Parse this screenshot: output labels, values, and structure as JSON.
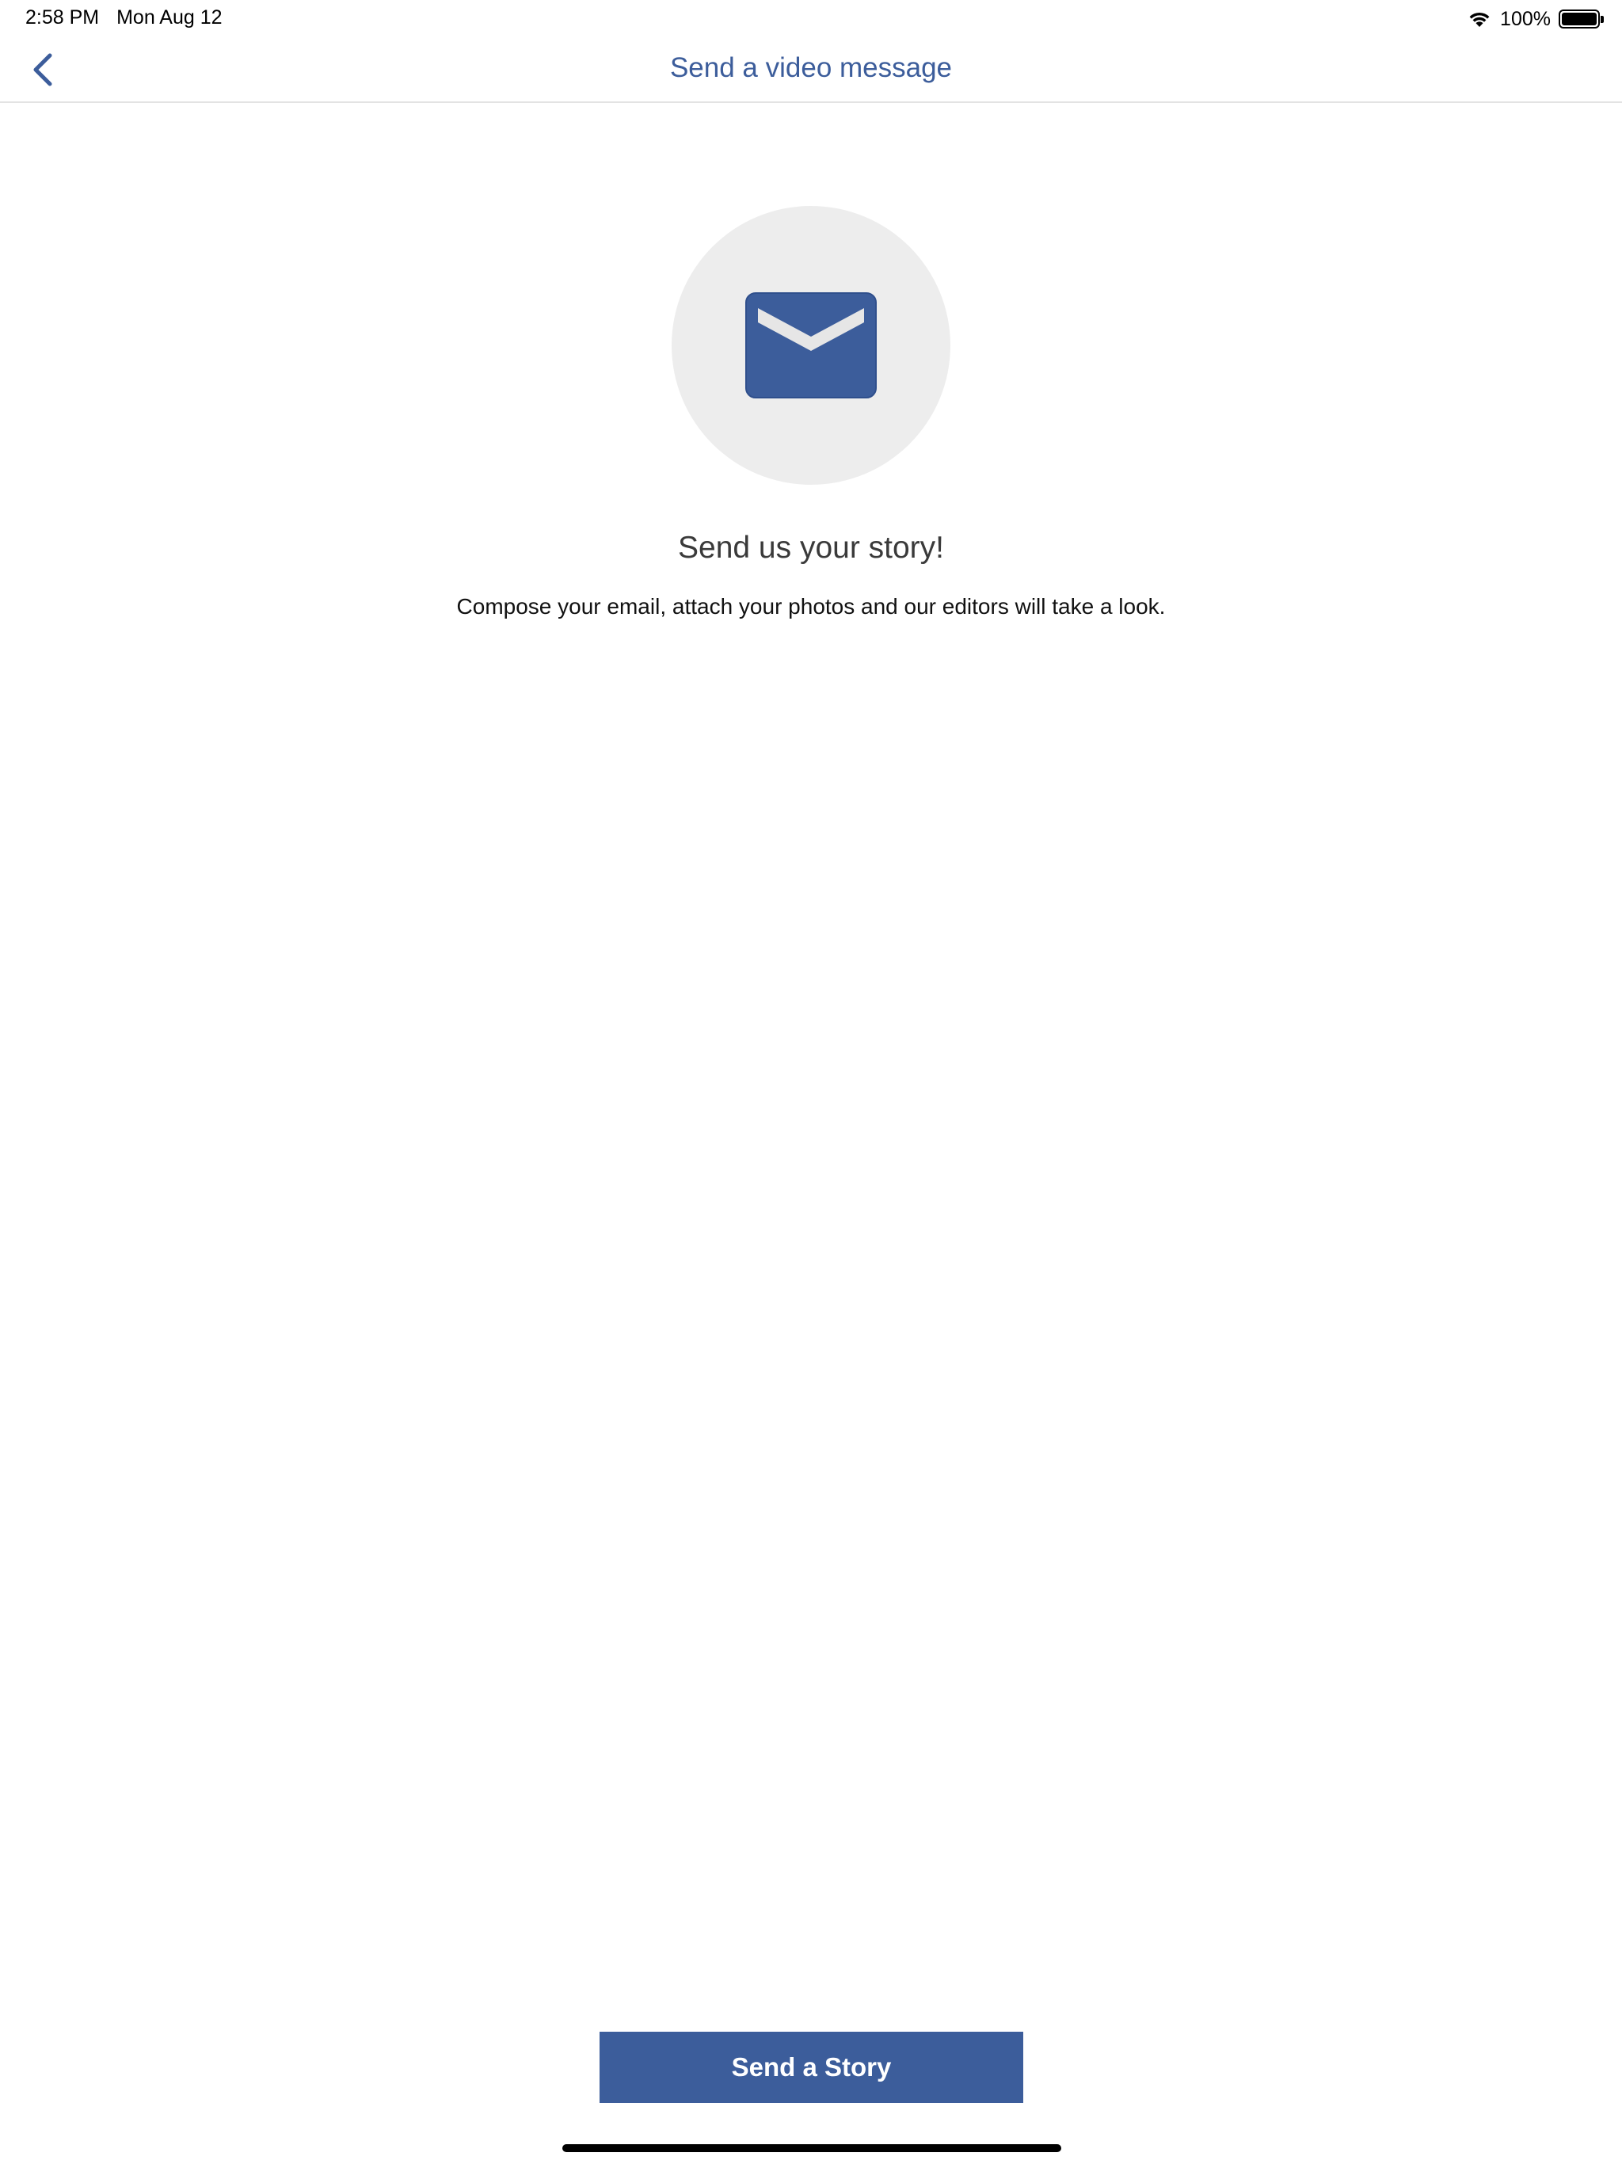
{
  "status_bar": {
    "time": "2:58 PM",
    "date": "Mon Aug 12",
    "battery_percent": "100%",
    "battery_level": 1.0,
    "wifi_icon": "wifi-icon",
    "battery_icon": "battery-icon"
  },
  "nav": {
    "title": "Send a video message",
    "back_icon": "chevron-left-icon"
  },
  "content": {
    "icon": "envelope-icon",
    "headline": "Send us your story!",
    "description": "Compose your email, attach your photos and our editors will take a look."
  },
  "actions": {
    "send_label": "Send a Story"
  },
  "colors": {
    "accent": "#3c5d9b",
    "icon_circle": "#ededed",
    "divider": "#e3e3e3"
  }
}
